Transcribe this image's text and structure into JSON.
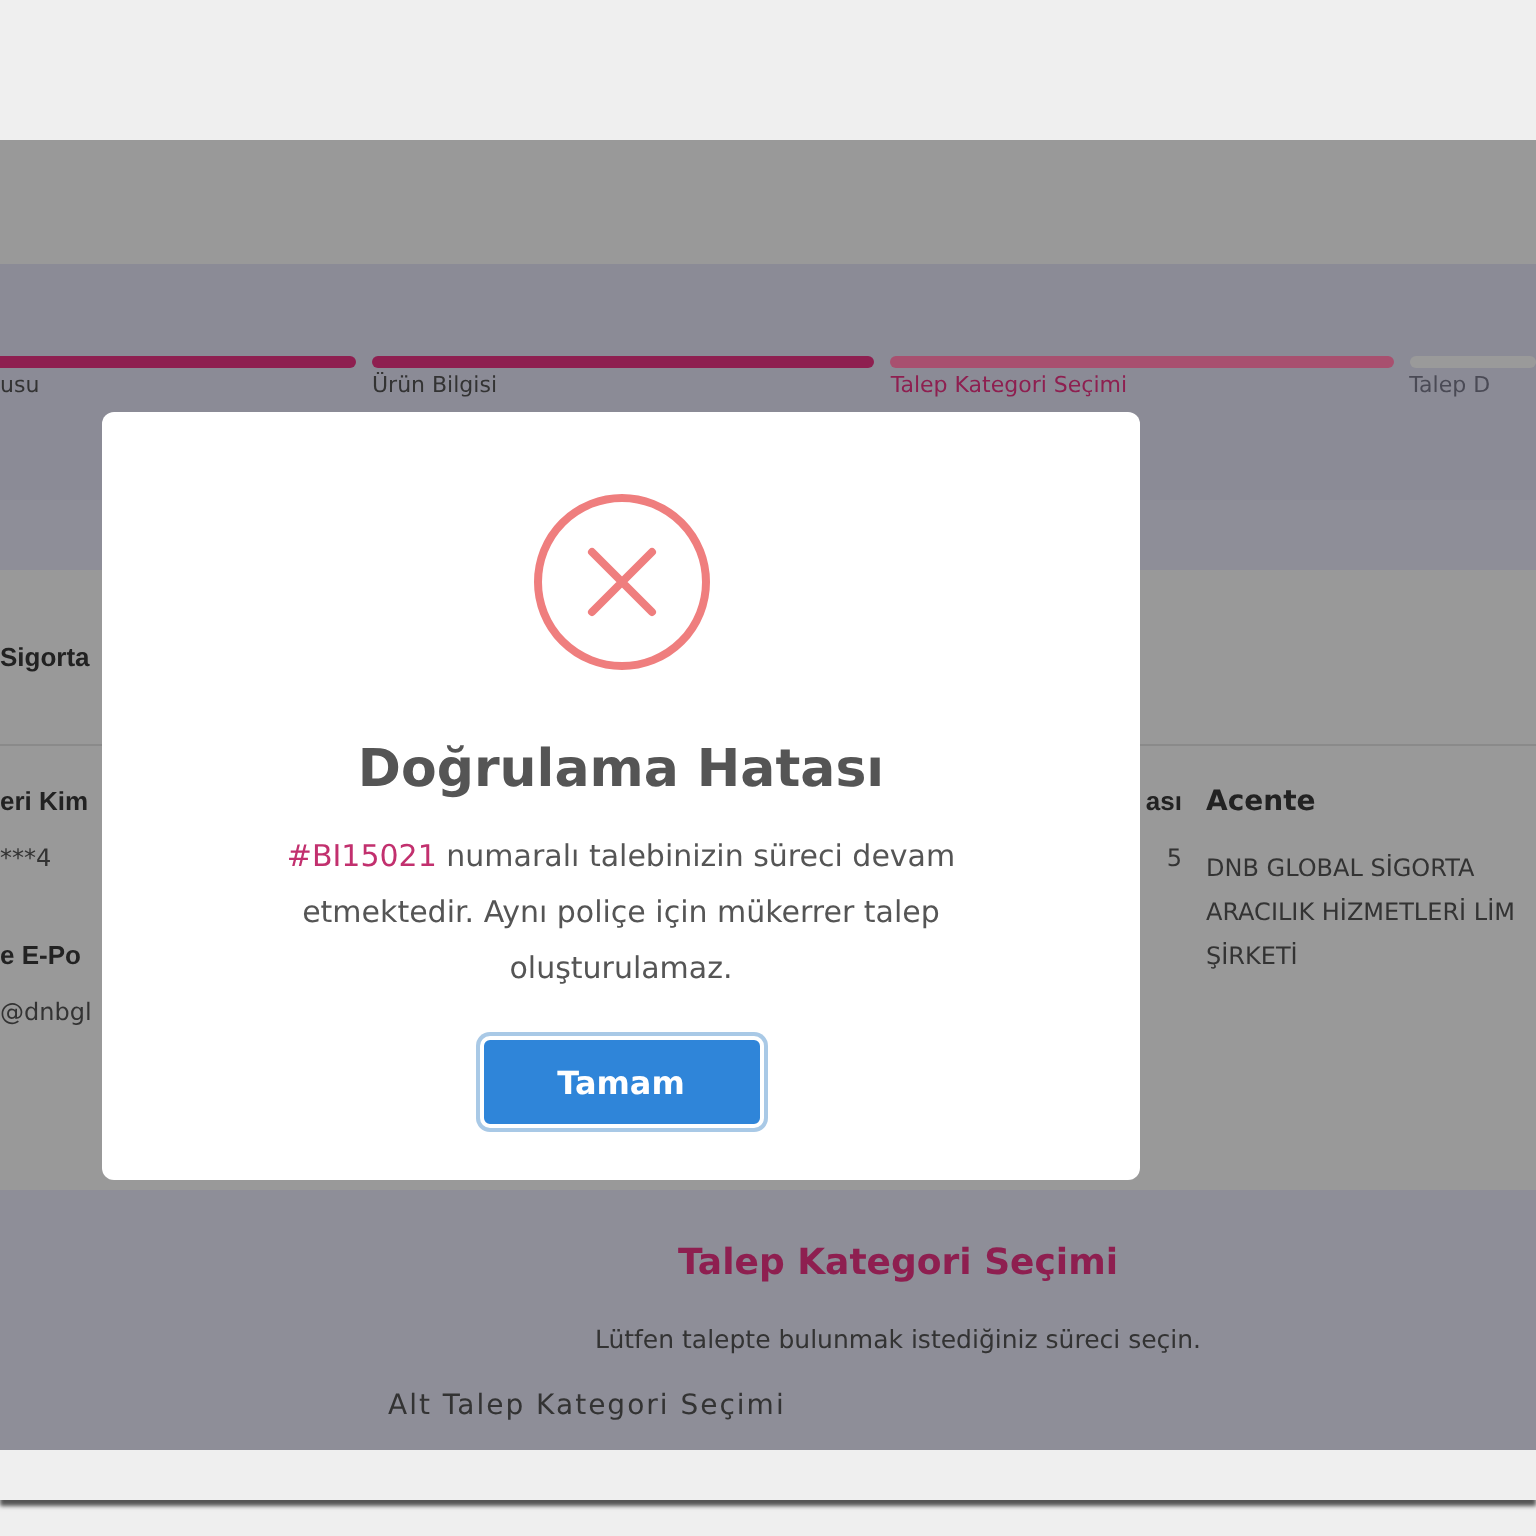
{
  "steps": [
    {
      "label": "usu",
      "completed": true,
      "selected": false
    },
    {
      "label": "Ürün Bilgisi",
      "completed": true,
      "selected": false
    },
    {
      "label": "Talep Kategori Seçimi",
      "completed": false,
      "selected": true
    },
    {
      "label": "Talep D",
      "completed": false,
      "selected": false
    }
  ],
  "details": {
    "left": [
      {
        "label": "Sigorta"
      }
    ],
    "rows_left": [
      {
        "label": "eri Kim",
        "value": "***4"
      },
      {
        "label": "e E-Po",
        "value": "@dnbgl"
      }
    ],
    "mid": {
      "label": "ası",
      "value": "5"
    },
    "agency": {
      "label": "Acente",
      "value": "DNB GLOBAL SİGORTA ARACILIK HİZMETLERİ LİM ŞİRKETİ"
    }
  },
  "category": {
    "title": "Talep Kategori Seçimi",
    "subtitle": "Lütfen talepte bulunmak istediğiniz süreci seçin.",
    "sub_label": "Alt Talep Kategori Seçimi"
  },
  "dialog": {
    "kind": "error",
    "title": "Doğrulama Hatası",
    "reference": "#BI15021",
    "message": "numaralı talebinizin süreci devam etmektedir. Aynı poliçe için mükerrer talep oluşturulamaz.",
    "button": "Tamam"
  }
}
